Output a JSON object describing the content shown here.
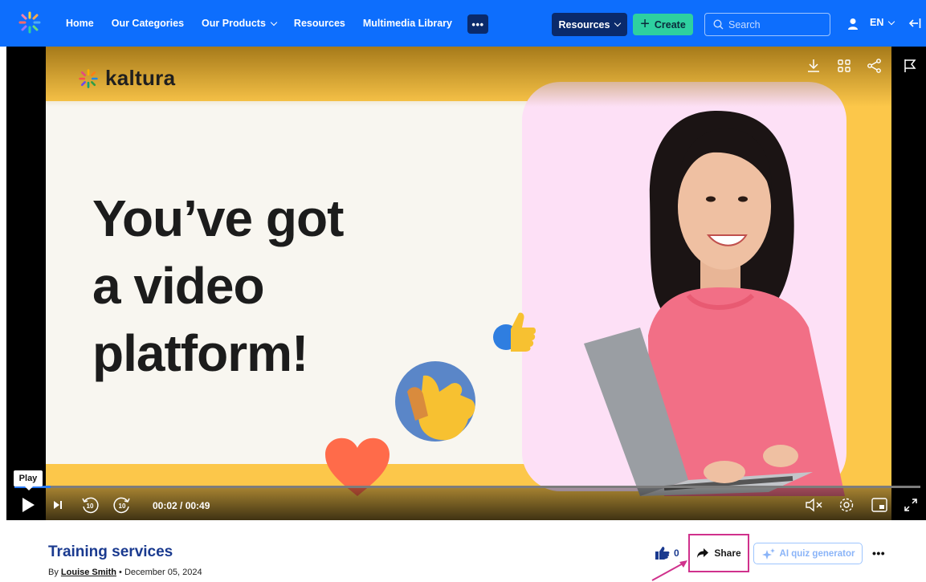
{
  "nav": {
    "links": [
      "Home",
      "Our Categories",
      "Our Products",
      "Resources",
      "Multimedia Library"
    ],
    "more_label": "•••",
    "resources_button": "Resources",
    "create_button": "Create",
    "search_placeholder": "Search",
    "language": "EN"
  },
  "player": {
    "brand": "kaltura",
    "headline": [
      "You’ve got",
      "a video",
      "platform!"
    ],
    "tooltip": "Play",
    "time": "00:02 / 00:49",
    "progress_fraction": 0.04,
    "skip_back": "10",
    "skip_forward": "10"
  },
  "media": {
    "title": "Training services",
    "by_prefix": "By",
    "author": "Louise Smith",
    "date": "December 05, 2024",
    "likes": "0",
    "share_label": "Share",
    "quiz_label": "AI quiz generator",
    "more_label": "•••"
  },
  "colors": {
    "nav_bg": "#0d6efd",
    "create": "#2ed0a0",
    "highlight": "#d0318c",
    "title": "#1a3a8f"
  }
}
